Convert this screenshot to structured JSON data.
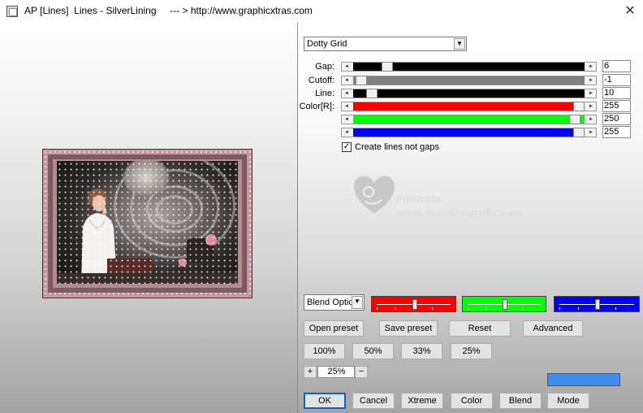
{
  "window": {
    "title": "AP [Lines]  Lines - SilverLining     --- > http://www.graphicxtras.com",
    "close_glyph": "✕"
  },
  "effect_dropdown": {
    "selected": "Dotty Grid"
  },
  "sliders": [
    {
      "label": "Gap:",
      "value": "6",
      "fraction": 0.13,
      "fill": "#000000"
    },
    {
      "label": "Cutoff:",
      "value": "-1",
      "fraction": 0.01,
      "fill": "#808080"
    },
    {
      "label": "Line:",
      "value": "10",
      "fraction": 0.06,
      "fill": "#000000"
    },
    {
      "label": "Color[R]:",
      "value": "255",
      "fraction": 1.0,
      "fill": "#ff0000"
    },
    {
      "label": "",
      "value": "250",
      "fraction": 0.98,
      "fill": "#00ff00"
    },
    {
      "label": "",
      "value": "255",
      "fraction": 1.0,
      "fill": "#0000ff"
    }
  ],
  "checkbox": {
    "label": "Create lines not gaps",
    "checked": true,
    "mark": "✓"
  },
  "watermark": {
    "name": "Pinuccia",
    "url": "www.maidiregrafica.eu"
  },
  "blend_dropdown": {
    "selected": "Blend Optio"
  },
  "color_boxes": [
    {
      "color": "#ff0000",
      "fraction": 0.5
    },
    {
      "color": "#00ff00",
      "fraction": 0.5
    },
    {
      "color": "#0000ff",
      "fraction": 0.5
    }
  ],
  "buttons_row1": [
    "Open preset",
    "Save preset",
    "Reset",
    "Advanced"
  ],
  "zoom_buttons": [
    "100%",
    "50%",
    "33%",
    "25%"
  ],
  "zoom_stepper": {
    "plus": "+",
    "value": "25%",
    "minus": "−"
  },
  "accent_color": "#3d8ef0",
  "bottom_buttons": [
    "OK",
    "Cancel",
    "Xtreme",
    "Color",
    "Blend",
    "Mode"
  ]
}
